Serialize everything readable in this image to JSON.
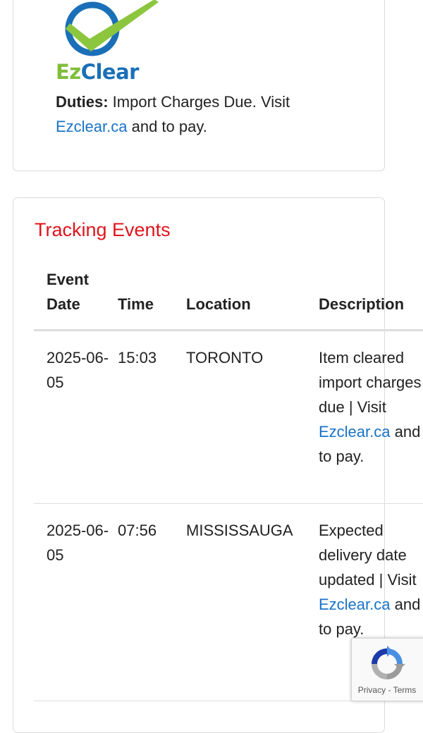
{
  "ezclear_logo": {
    "ez": "Ez",
    "clear": "Clear"
  },
  "duties": {
    "label": "Duties:",
    "text_before": " Import Charges Due. Visit ",
    "link": "Ezclear.ca",
    "text_after": " and to pay."
  },
  "tracking": {
    "title": "Tracking Events",
    "columns": {
      "date": "Event Date",
      "time": "Time",
      "location": "Location",
      "description": "Description"
    },
    "rows": [
      {
        "date": "2025-06-05",
        "time": "15:03",
        "location": "TORONTO",
        "description_text": "Item cleared import charges due | Visit ",
        "description_link": "Ezclear.ca",
        "description_after": " and to pay."
      },
      {
        "date": "2025-06-05",
        "time": "07:56",
        "location": "MISSISSAUGA",
        "description_text": "Expected delivery date updated | Visit ",
        "description_link": "Ezclear.ca",
        "description_after": " and to pay."
      }
    ]
  },
  "recaptcha": {
    "privacy": "Privacy",
    "separator": "-",
    "terms": "Terms"
  },
  "colors": {
    "title_red": "#e0141c",
    "link_blue": "#1a73c8",
    "logo_green": "#7fbe3b",
    "logo_blue": "#1a6fb8"
  }
}
